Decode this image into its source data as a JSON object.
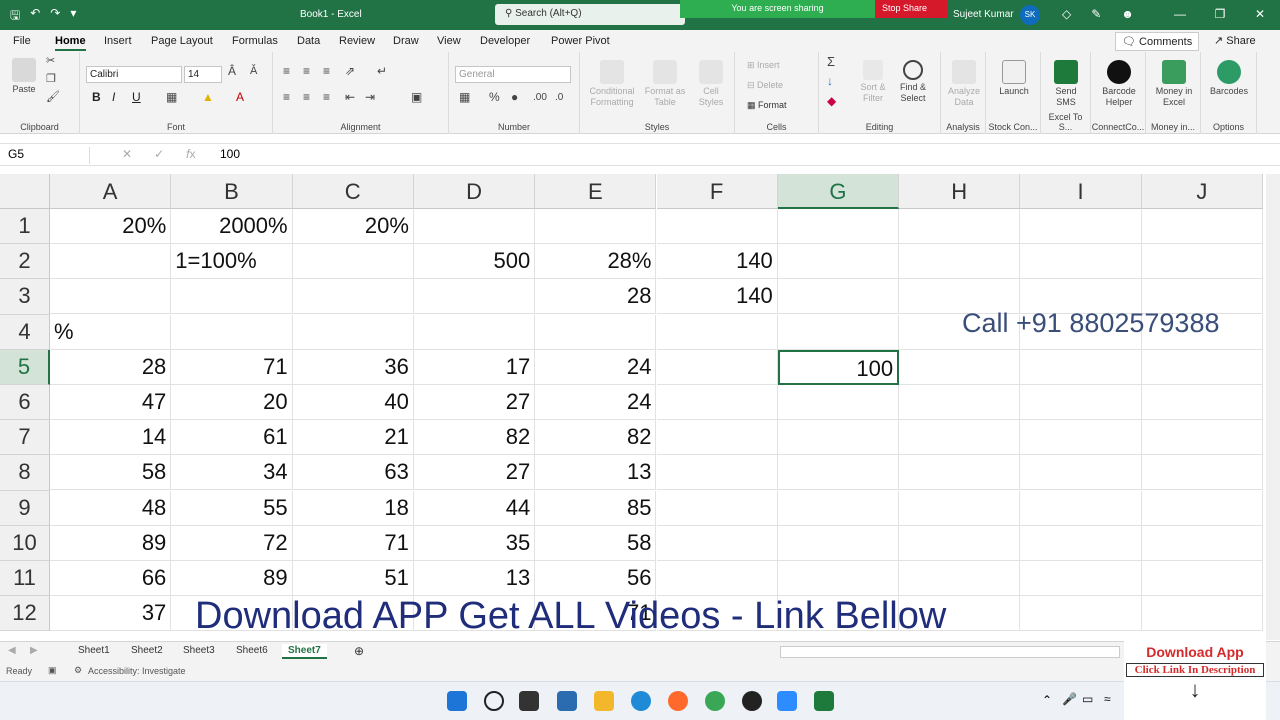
{
  "titlebar": {
    "doc_title": "Book1 - Excel",
    "search_placeholder": "Search (Alt+Q)",
    "sharing_text": "You are screen sharing",
    "stop_share": "Stop Share",
    "user_name": "Sujeet Kumar",
    "user_initials": "SK"
  },
  "tabs": [
    "File",
    "Home",
    "Insert",
    "Page Layout",
    "Formulas",
    "Data",
    "Review",
    "Draw",
    "View",
    "Developer",
    "Power Pivot"
  ],
  "active_tab": "Home",
  "comments_label": "Comments",
  "share_label": "Share",
  "ribbon": {
    "paste": "Paste",
    "clipboard": "Clipboard",
    "font_name": "Calibri",
    "font_size": "14",
    "font_group": "Font",
    "alignment_group": "Alignment",
    "number_format": "General",
    "number_group": "Number",
    "conditional_formatting": "Conditional Formatting",
    "format_as_table": "Format as Table",
    "cell_styles": "Cell Styles",
    "styles_group": "Styles",
    "insert": "Insert",
    "delete": "Delete",
    "format": "Format",
    "cells_group": "Cells",
    "sort_filter": "Sort & Filter",
    "find_select": "Find & Select",
    "editing_group": "Editing",
    "analyze_data": "Analyze Data",
    "analysis_group": "Analysis",
    "launch": "Launch",
    "stock_group": "Stock Con...",
    "send_sms": "Send SMS",
    "excel_sms_group": "Excel To S...",
    "barcode_helper": "Barcode Helper",
    "connectco_group": "ConnectCo...",
    "money_in_excel": "Money in Excel",
    "money_group": "Money in...",
    "barcodes": "Barcodes",
    "options_group": "Options"
  },
  "formula_bar": {
    "name_box": "G5",
    "formula": "100"
  },
  "columns": [
    "A",
    "B",
    "C",
    "D",
    "E",
    "F",
    "G",
    "H",
    "I",
    "J"
  ],
  "selected_col": "G",
  "selected_row": "5",
  "rows": [
    {
      "n": "1",
      "cells": [
        "20%",
        "2000%",
        "20%",
        "",
        "",
        "",
        "",
        "",
        "",
        ""
      ]
    },
    {
      "n": "2",
      "cells": [
        "",
        "1=100%",
        "",
        "500",
        "28%",
        "140",
        "",
        "",
        "",
        ""
      ]
    },
    {
      "n": "3",
      "cells": [
        "",
        "",
        "",
        "",
        "28",
        "140",
        "",
        "",
        "",
        ""
      ]
    },
    {
      "n": "4",
      "cells": [
        "%",
        "",
        "",
        "",
        "",
        "",
        "",
        "",
        "",
        ""
      ]
    },
    {
      "n": "5",
      "cells": [
        "28",
        "71",
        "36",
        "17",
        "24",
        "",
        "100",
        "",
        "",
        ""
      ]
    },
    {
      "n": "6",
      "cells": [
        "47",
        "20",
        "40",
        "27",
        "24",
        "",
        "",
        "",
        "",
        ""
      ]
    },
    {
      "n": "7",
      "cells": [
        "14",
        "61",
        "21",
        "82",
        "82",
        "",
        "",
        "",
        "",
        ""
      ]
    },
    {
      "n": "8",
      "cells": [
        "58",
        "34",
        "63",
        "27",
        "13",
        "",
        "",
        "",
        "",
        ""
      ]
    },
    {
      "n": "9",
      "cells": [
        "48",
        "55",
        "18",
        "44",
        "85",
        "",
        "",
        "",
        "",
        ""
      ]
    },
    {
      "n": "10",
      "cells": [
        "89",
        "72",
        "71",
        "35",
        "58",
        "",
        "",
        "",
        "",
        ""
      ]
    },
    {
      "n": "11",
      "cells": [
        "66",
        "89",
        "51",
        "13",
        "56",
        "",
        "",
        "",
        "",
        ""
      ]
    },
    {
      "n": "12",
      "cells": [
        "37",
        "",
        "",
        "",
        "71",
        "",
        "",
        "",
        "",
        ""
      ]
    }
  ],
  "overlay": {
    "call": "Call +91 8802579388",
    "download": "Download APP Get ALL Videos -  Link Bellow"
  },
  "sheets": [
    "Sheet1",
    "Sheet2",
    "Sheet3",
    "Sheet6",
    "Sheet7"
  ],
  "active_sheet": "Sheet7",
  "status": {
    "ready": "Ready",
    "accessibility": "Accessibility: Investigate"
  },
  "download_app": {
    "title": "Download App",
    "sub": "Click Link In Description"
  }
}
